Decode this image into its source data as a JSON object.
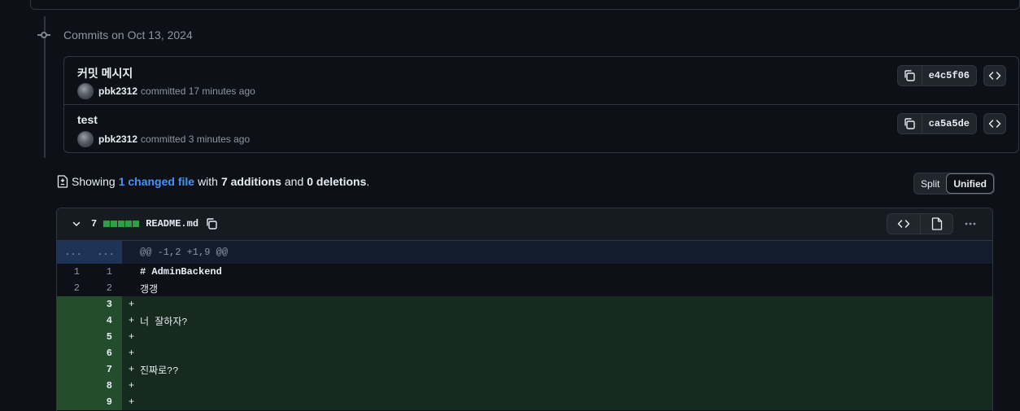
{
  "commits_group": {
    "date_label": "Commits on Oct 13, 2024",
    "commits": [
      {
        "title": "커밋 메시지",
        "author": "pbk2312",
        "action": "committed",
        "time": "17 minutes ago",
        "sha": "e4c5f06"
      },
      {
        "title": "test",
        "author": "pbk2312",
        "action": "committed",
        "time": "3 minutes ago",
        "sha": "ca5a5de"
      }
    ]
  },
  "summary": {
    "prefix": "Showing",
    "changed_files": "1 changed file",
    "with": "with",
    "additions": "7 additions",
    "and": "and",
    "deletions": "0 deletions",
    "suffix": "."
  },
  "view_toggle": {
    "split_label": "Split",
    "unified_label": "Unified",
    "selected": "Unified"
  },
  "file": {
    "change_count": "7",
    "filename": "README.md",
    "diffstat_color": "#2ea043",
    "hunk": {
      "left_gutter": "...",
      "right_gutter": "...",
      "header": "@@ -1,2 +1,9 @@"
    },
    "lines": [
      {
        "type": "context",
        "old": "1",
        "new": "1",
        "text": "# AdminBackend"
      },
      {
        "type": "context",
        "old": "2",
        "new": "2",
        "text": "갱갱"
      },
      {
        "type": "add",
        "old": "",
        "new": "3",
        "marker": "+",
        "text": ""
      },
      {
        "type": "add",
        "old": "",
        "new": "4",
        "marker": "+",
        "text": "너 잘하자?"
      },
      {
        "type": "add",
        "old": "",
        "new": "5",
        "marker": "+",
        "text": ""
      },
      {
        "type": "add",
        "old": "",
        "new": "6",
        "marker": "+",
        "text": ""
      },
      {
        "type": "add",
        "old": "",
        "new": "7",
        "marker": "+",
        "text": "진짜로??"
      },
      {
        "type": "add",
        "old": "",
        "new": "8",
        "marker": "+",
        "text": ""
      },
      {
        "type": "add",
        "old": "",
        "new": "9",
        "marker": "+",
        "text": ""
      }
    ]
  },
  "colors": {
    "background": "#0d1117",
    "link": "#4493f8",
    "addition_bg": "#172a1f",
    "addition_gutter": "#244d2e",
    "hunk_bg": "#131d2e"
  }
}
